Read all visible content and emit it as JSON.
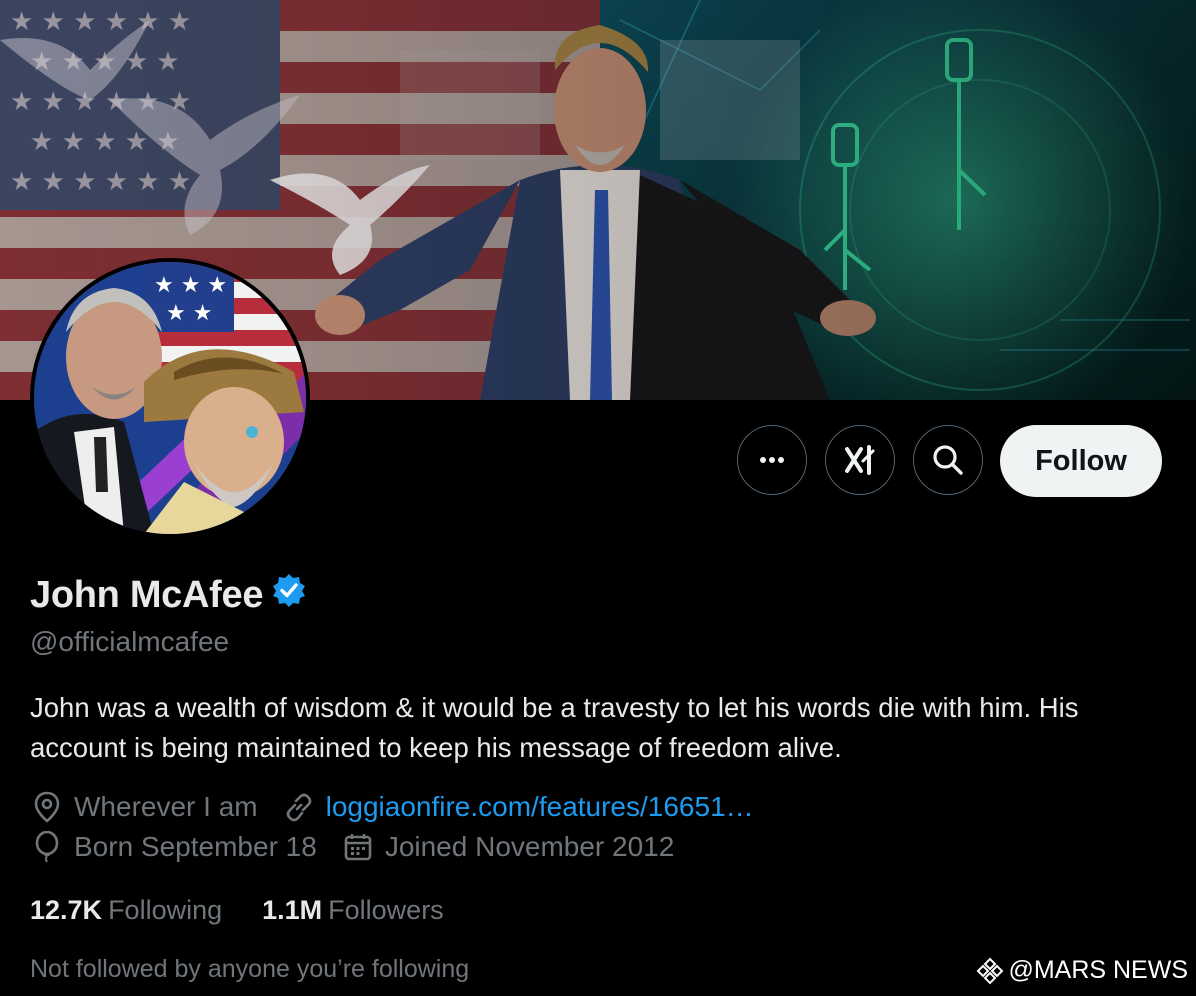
{
  "colors": {
    "background": "#000000",
    "text_primary": "#e7e9ea",
    "text_secondary": "#71767b",
    "link": "#1d9bf0",
    "verified": "#1d9bf0",
    "follow_button_bg": "#eff3f4"
  },
  "banner": {
    "image": "cover-image-portrait-flag-and-circuit-keys"
  },
  "avatar": {
    "image": "profile-photo-portrait-and-illustration"
  },
  "actions": {
    "more_icon": "more-horizontal-icon",
    "grok_icon": "grok-icon",
    "search_icon": "search-icon",
    "follow_label": "Follow"
  },
  "profile": {
    "name": "John McAfee",
    "verified_icon": "verified-badge-icon",
    "handle": "@officialmcafee",
    "bio": "John was a wealth of wisdom & it would be a travesty to let his words die with him. His account is being maintained to keep his message of freedom alive.",
    "location": "Wherever I am",
    "website": "loggiaonfire.com/features/16651…",
    "birthday": "Born September 18",
    "joined": "Joined November 2012"
  },
  "stats": {
    "following_count": "12.7K",
    "following_label": "Following",
    "followers_count": "1.1M",
    "followers_label": "Followers"
  },
  "social_context": "Not followed by anyone you’re following",
  "watermark": {
    "icon": "diamond-logo-icon",
    "text": "@MARS NEWS"
  }
}
